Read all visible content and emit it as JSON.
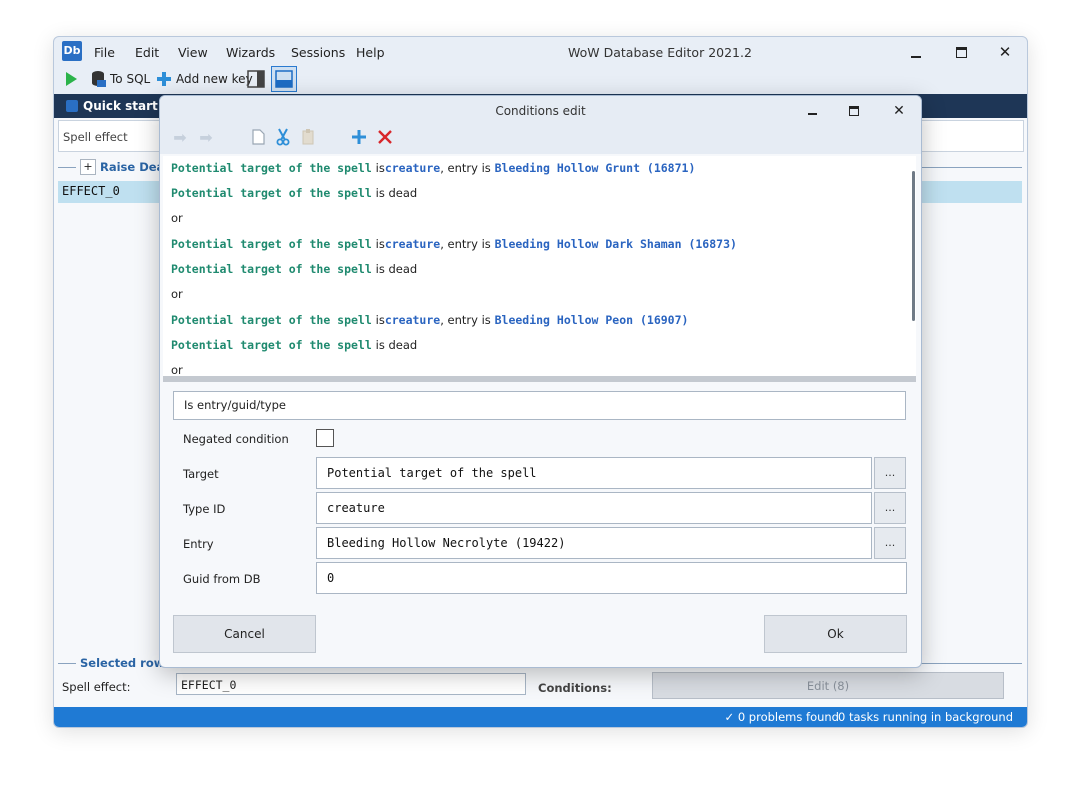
{
  "app": {
    "title": "WoW Database Editor 2021.2",
    "logo_text": "Db",
    "menu": [
      "File",
      "Edit",
      "View",
      "Wizards",
      "Sessions",
      "Help"
    ]
  },
  "toolbar": {
    "to_sql_label": "To SQL",
    "add_key_label": "Add new key"
  },
  "tabs": {
    "quick_start": "Quick start"
  },
  "table": {
    "column_label": "Spell effect",
    "group_label": "Raise Dead (",
    "expander": "+",
    "row_value": "EFFECT_0"
  },
  "selected_row": {
    "label": "Selected row",
    "spell_effect_label": "Spell effect:",
    "spell_effect_value": "EFFECT_0",
    "conditions_label": "Conditions:",
    "edit_button": "Edit (8)"
  },
  "status": {
    "problems": "✓ 0 problems found",
    "tasks": "0 tasks running in background"
  },
  "dialog": {
    "title": "Conditions edit",
    "conditions": [
      {
        "target": "Potential target of the spell",
        "text1": "is",
        "type": "creature",
        "text2": ", entry is",
        "entry": "Bleeding Hollow Grunt (16871)"
      },
      {
        "target": "Potential target of the spell",
        "text1": "is dead"
      },
      {
        "or": "or"
      },
      {
        "target": "Potential target of the spell",
        "text1": "is",
        "type": "creature",
        "text2": ", entry is",
        "entry": "Bleeding Hollow Dark Shaman (16873)"
      },
      {
        "target": "Potential target of the spell",
        "text1": "is dead"
      },
      {
        "or": "or"
      },
      {
        "target": "Potential target of the spell",
        "text1": "is",
        "type": "creature",
        "text2": ", entry is",
        "entry": "Bleeding Hollow Peon (16907)"
      },
      {
        "target": "Potential target of the spell",
        "text1": "is dead"
      },
      {
        "or": "or"
      }
    ],
    "condition_type": "Is entry/guid/type",
    "fields": {
      "negated_label": "Negated condition",
      "negated_checked": false,
      "target_label": "Target",
      "target_value": "Potential target of the spell",
      "type_label": "Type ID",
      "type_value": "creature",
      "entry_label": "Entry",
      "entry_value": "Bleeding Hollow Necrolyte (19422)",
      "guid_label": "Guid from DB",
      "guid_value": "0",
      "picker_label": "..."
    },
    "cancel": "Cancel",
    "ok": "Ok"
  },
  "colors": {
    "accent": "#1f7ad4",
    "tabbar": "#1e3656",
    "condition_target": "#1f8a6f",
    "condition_value": "#2a64c0",
    "delete_red": "#d8262a"
  }
}
